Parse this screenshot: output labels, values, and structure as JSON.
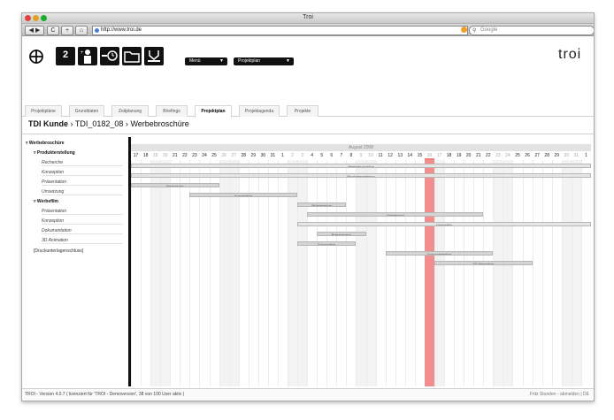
{
  "window": {
    "title": "Troi"
  },
  "browser": {
    "back": "◀ ▶",
    "reload": "C",
    "add": "+",
    "home": "⌂",
    "url": "http://www.troi.de",
    "search_placeholder": "Google"
  },
  "header": {
    "brand": "troi",
    "badge_number": "2",
    "menu_label": "Menü",
    "project_label": "Projektplan"
  },
  "tabs": [
    {
      "label": "Projektpläne"
    },
    {
      "label": "Grunddaten"
    },
    {
      "label": "Zeitplanung"
    },
    {
      "label": "Briefings"
    },
    {
      "label": "Projektplan"
    },
    {
      "label": "Projektagenda"
    },
    {
      "label": "Projekte"
    }
  ],
  "breadcrumb": {
    "client": "TDI Kunde",
    "sep1": "›",
    "project": "TDI_0182_08",
    "sep2": "›",
    "page": "Werbebroschüre"
  },
  "tree": [
    {
      "label": "Werbebroschüre",
      "level": 0
    },
    {
      "label": "Produkterstellung",
      "level": 1
    },
    {
      "label": "Recherche",
      "level": 2
    },
    {
      "label": "Konzeption",
      "level": 2
    },
    {
      "label": "Präsentation",
      "level": 2
    },
    {
      "label": "Umsetzung",
      "level": 2
    },
    {
      "label": "Werbefilm",
      "level": 1
    },
    {
      "label": "Präsentation",
      "level": 2
    },
    {
      "label": "Konzeption",
      "level": 2
    },
    {
      "label": "Dokumentation",
      "level": 2
    },
    {
      "label": "3D Animation",
      "level": 2
    },
    {
      "label": "[Druckunterlagenschluss]",
      "level": 1
    }
  ],
  "gantt": {
    "month": "August 2008",
    "days": [
      "17",
      "18",
      "19",
      "20",
      "21",
      "22",
      "23",
      "24",
      "25",
      "26",
      "27",
      "28",
      "29",
      "30",
      "31",
      "1",
      "2",
      "3",
      "4",
      "5",
      "6",
      "7",
      "8",
      "9",
      "10",
      "11",
      "12",
      "13",
      "14",
      "15",
      "16",
      "17",
      "18",
      "19",
      "20",
      "21",
      "22",
      "23",
      "24",
      "25",
      "26",
      "27",
      "28",
      "29",
      "30",
      "31",
      "1"
    ],
    "weekend_index": [
      2,
      3,
      9,
      10,
      16,
      17,
      23,
      24,
      30,
      31,
      37,
      38,
      44,
      45
    ],
    "today_index": 30,
    "bars": [
      {
        "label": "Werbebroschüre",
        "start": 0,
        "end": 46,
        "row": 0
      },
      {
        "label": "Produkterstellung",
        "start": 0,
        "end": 46,
        "row": 1
      },
      {
        "label": "Recherche",
        "start": 0,
        "end": 8,
        "row": 2
      },
      {
        "label": "Konzeption",
        "start": 6,
        "end": 16,
        "row": 3
      },
      {
        "label": "Präsentation",
        "start": 17,
        "end": 21,
        "row": 4
      },
      {
        "label": "Umsetzung",
        "start": 18,
        "end": 35,
        "row": 5
      },
      {
        "label": "Werbefilm",
        "start": 17,
        "end": 46,
        "row": 6
      },
      {
        "label": "Präsentation",
        "start": 19,
        "end": 23,
        "row": 7
      },
      {
        "label": "Konzeption",
        "start": 17,
        "end": 22,
        "row": 8
      },
      {
        "label": "Dokumentation",
        "start": 26,
        "end": 36,
        "row": 9
      },
      {
        "label": "3D Animation",
        "start": 31,
        "end": 40,
        "row": 10
      }
    ]
  },
  "status": {
    "left": "TROI - Version 4.0.7 ( lizenziert für 'TROI - Demoversion', 38 von 100 User aktiv )",
    "right": "Fritz Stunden - abmelden | DE"
  }
}
